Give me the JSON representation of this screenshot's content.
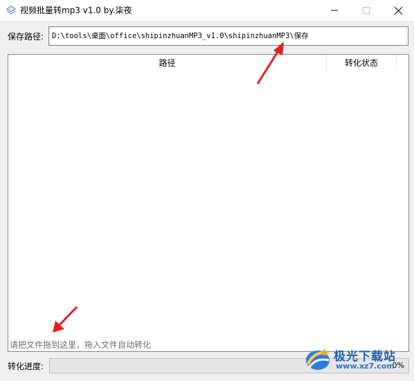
{
  "window": {
    "title": "视频批量转mp3 v1.0  by.柒夜",
    "icons": {
      "app": "app-logo-icon",
      "minimize": "minimize-icon",
      "maximize": "maximize-icon",
      "close": "close-icon"
    }
  },
  "save": {
    "label": "保存路径:",
    "value": "D:\\tools\\桌面\\office\\shipinzhuanMP3_v1.0\\shipinzhuanMP3\\保存"
  },
  "list": {
    "columns": [
      "路径",
      "转化状态"
    ],
    "rows": [],
    "drop_hint": "请把文件拖到这里，拖入文件自动转化"
  },
  "progress": {
    "label": "转化进度:",
    "value": 0,
    "text": "0%"
  },
  "annotations": {
    "arrow_color": "#e02020"
  },
  "watermark": {
    "brand": "极光下载站",
    "url": "www.xz7.com",
    "icon": "aurora-logo-icon"
  }
}
